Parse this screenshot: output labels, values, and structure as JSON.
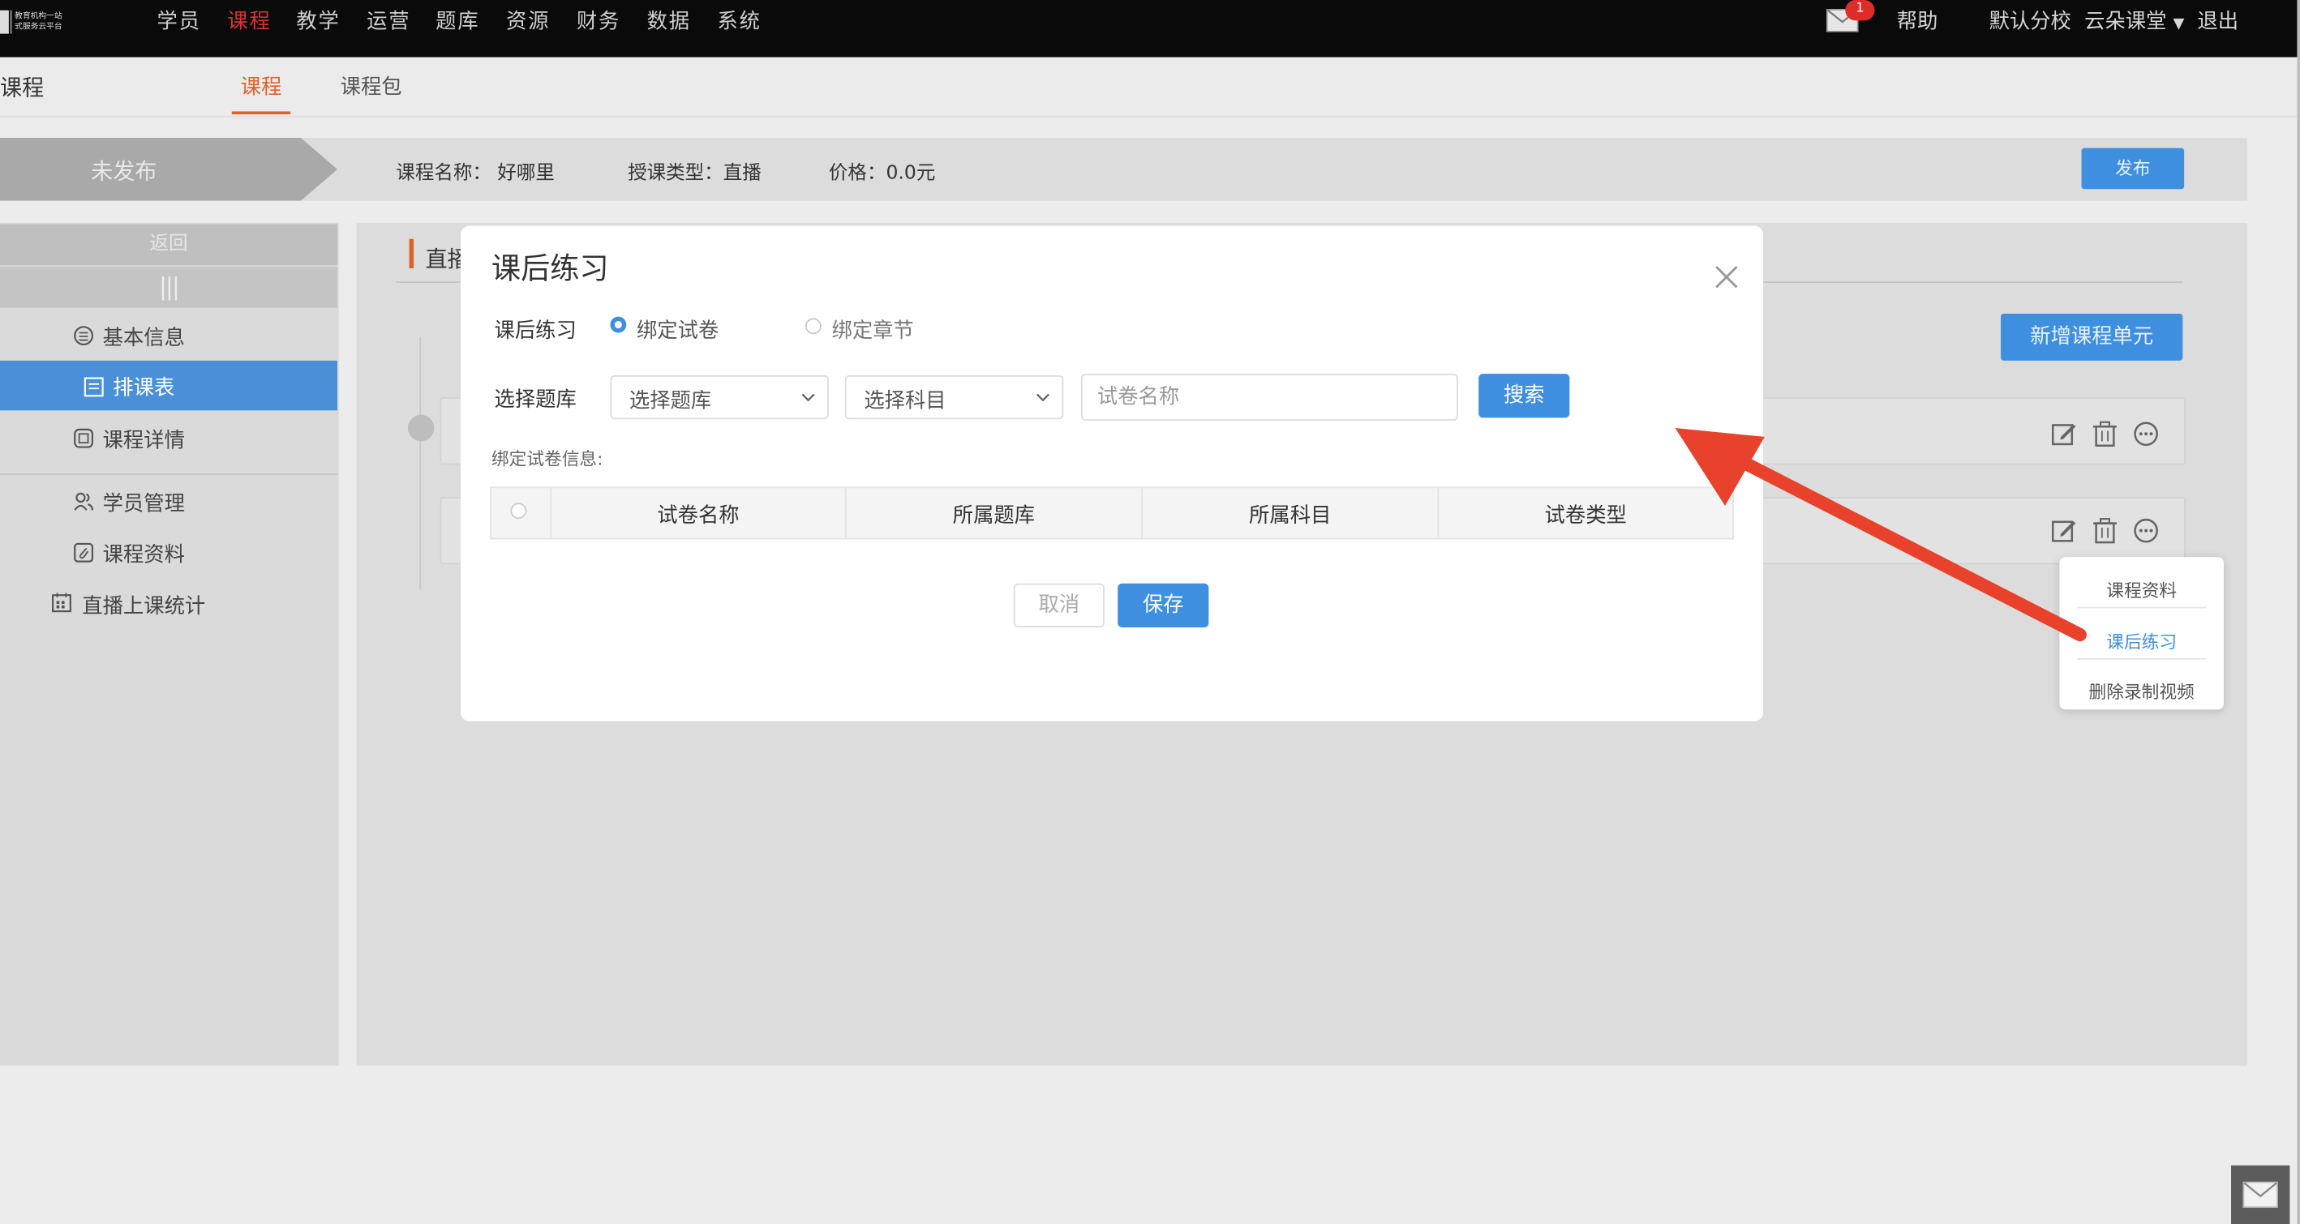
{
  "logo": {
    "line1": "教育机构一站",
    "line2": "式服务云平台"
  },
  "nav": {
    "items": [
      "学员",
      "课程",
      "教学",
      "运营",
      "题库",
      "资源",
      "财务",
      "数据",
      "系统"
    ],
    "active": "课程",
    "notification_count": "1",
    "help": "帮助",
    "school": "默认分校",
    "user": "云朵课堂",
    "logout": "退出"
  },
  "subheader": {
    "title": "课程",
    "tabs": [
      "课程",
      "课程包"
    ]
  },
  "status": {
    "state": "未发布",
    "course_name": "课程名称： 好哪里",
    "teach_type": "授课类型：直播",
    "price": "价格：0.0元",
    "publish": "发布"
  },
  "sidebar": {
    "back": "返回",
    "items": [
      "基本信息",
      "排课表",
      "课程详情",
      "学员管理",
      "课程资料",
      "直播上课统计"
    ],
    "active": "排课表"
  },
  "main": {
    "heading": "直播",
    "add_unit": "新增课程单元"
  },
  "dropdown": {
    "items": [
      "课程资料",
      "课后练习",
      "删除录制视频"
    ],
    "active": "课后练习"
  },
  "modal": {
    "title": "课后练习",
    "practice_label": "课后练习",
    "radio_paper": "绑定试卷",
    "radio_chapter": "绑定章节",
    "select_bank_label": "选择题库",
    "bank_placeholder": "选择题库",
    "subject_placeholder": "选择科目",
    "paper_placeholder": "试卷名称",
    "search": "搜索",
    "bind_info": "绑定试卷信息:",
    "columns": [
      "试卷名称",
      "所属题库",
      "所属科目",
      "试卷类型"
    ],
    "cancel": "取消",
    "save": "保存"
  },
  "colors": {
    "accent": "#3f8fe0",
    "brand": "#d9342b",
    "tab": "#e0612c",
    "arrow": "#e8412c"
  }
}
